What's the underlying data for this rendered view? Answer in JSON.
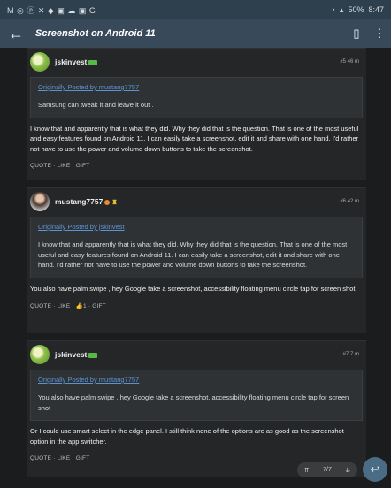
{
  "status_bar": {
    "left_icons": "M ◎ ⓟ ✕ ◆ ▣ ☁ ▣ G",
    "battery": "50%",
    "time": "8:47"
  },
  "app_bar": {
    "title": "Screenshot on Android 11"
  },
  "posts": [
    {
      "username": "jskinvest",
      "meta": "#5 46 m",
      "quote_head": "Originally Posted by mustang7757",
      "quote_body": "Samsung can tweak it and leave it out .",
      "body": "I know that and apparently that is what they did. Why they did that is the question. That is one of the most useful and easy features found on Android 11. I can easily take a screenshot, edit it and share with one hand. I'd rather not have to use the power and volume down buttons to take the screenshot.",
      "actions": "QUOTE · LIKE · GIFT"
    },
    {
      "username": "mustang7757",
      "meta": "#6 42 m",
      "quote_head": "Originally Posted by jskinvest",
      "quote_body": "I know that and apparently that is what they did. Why they did that is the question. That is one of the most useful and easy features found on Android 11. I can easily take a screenshot, edit it and share with one hand. I'd rather not have to use the power and volume down buttons to take the screenshot.",
      "body": "You also have palm swipe , hey Google take a screenshot, accessibility floating menu circle tap for screen shot",
      "actions": "QUOTE · LIKE · 👍1 · GIFT"
    },
    {
      "username": "jskinvest",
      "meta": "#7 7 m",
      "quote_head": "Originally Posted by mustang7757",
      "quote_body": "You also have palm swipe , hey Google take a screenshot, accessibility floating menu circle tap for screen shot",
      "body": "Or I could use smart select in the edge panel. I still think none of the options are as good as the screenshot option in the app switcher.",
      "actions": "QUOTE · LIKE · GIFT"
    }
  ],
  "pager": {
    "up": "⇈",
    "page": "7/7",
    "down": "⇊"
  },
  "fab_icon": "reply-icon"
}
